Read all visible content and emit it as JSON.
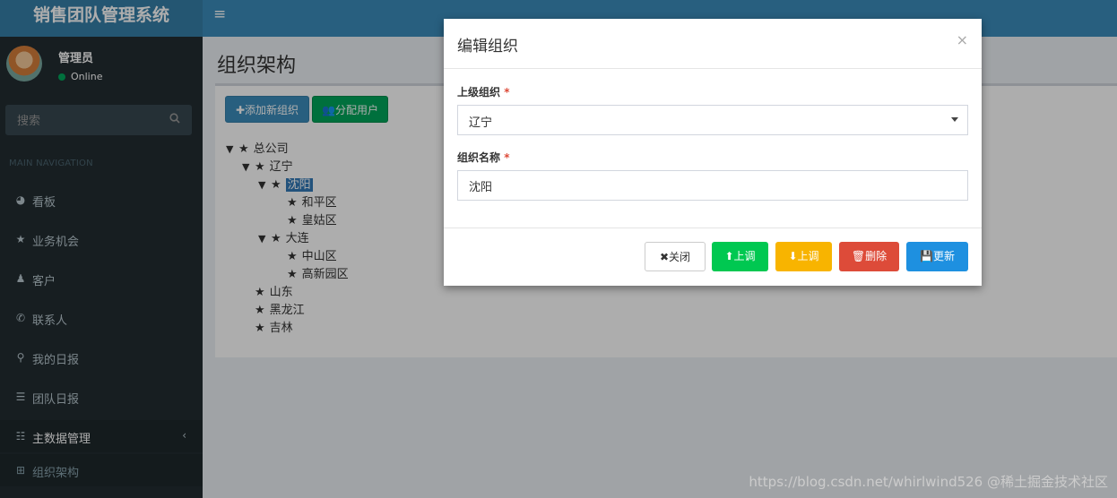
{
  "header": {
    "brand": "销售团队管理系统",
    "menu_icon": "≡"
  },
  "user": {
    "name": "管理员",
    "status": "Online"
  },
  "search": {
    "placeholder": "搜索"
  },
  "nav": {
    "header": "MAIN NAVIGATION",
    "items": [
      {
        "icon": "dashboard-icon",
        "glyph": "◕",
        "label": "看板"
      },
      {
        "icon": "star-icon",
        "glyph": "★",
        "label": "业务机会"
      },
      {
        "icon": "user-icon",
        "glyph": "♟",
        "label": "客户"
      },
      {
        "icon": "phone-icon",
        "glyph": "✆",
        "label": "联系人"
      },
      {
        "icon": "pin-icon",
        "glyph": "⚲",
        "label": "我的日报"
      },
      {
        "icon": "list-icon",
        "glyph": "☰",
        "label": "团队日报"
      },
      {
        "icon": "database-icon",
        "glyph": "☷",
        "label": "主数据管理",
        "chevron": "‹"
      },
      {
        "icon": "sitemap-icon",
        "glyph": "⊞",
        "label": "组织架构"
      }
    ]
  },
  "page": {
    "title": "组织架构"
  },
  "toolbar": {
    "add_label": "✚添加新组织",
    "assign_label": "👥分配用户"
  },
  "tree": [
    {
      "label": "总公司",
      "caret": "▼"
    },
    {
      "label": "辽宁",
      "caret": "▼"
    },
    {
      "label": "沈阳",
      "caret": "▼",
      "selected": true
    },
    {
      "label": "和平区",
      "caret": ""
    },
    {
      "label": "皇姑区",
      "caret": ""
    },
    {
      "label": "大连",
      "caret": "▼"
    },
    {
      "label": "中山区",
      "caret": ""
    },
    {
      "label": "高新园区",
      "caret": ""
    },
    {
      "label": "山东",
      "caret": ""
    },
    {
      "label": "黑龙江",
      "caret": ""
    },
    {
      "label": "吉林",
      "caret": ""
    }
  ],
  "modal": {
    "title": "编辑组织",
    "close": "×",
    "parent_label": "上级组织",
    "parent_value": "辽宁",
    "name_label": "组织名称",
    "name_value": "沈阳",
    "required_mark": "*",
    "buttons": {
      "close": "✖关闭",
      "up": "⬆上调",
      "down": "⬇上调",
      "delete": "🗑删除",
      "update": "💾更新"
    }
  },
  "watermark": "https://blog.csdn.net/whirlwind526 @稀土掘金技术社区",
  "colors": {
    "header": "#3c8dbc",
    "sidebar": "#222d32",
    "primary": "#3c8dbc",
    "success": "#00a65a",
    "danger": "#dd4b39",
    "warning": "#f8b400"
  }
}
